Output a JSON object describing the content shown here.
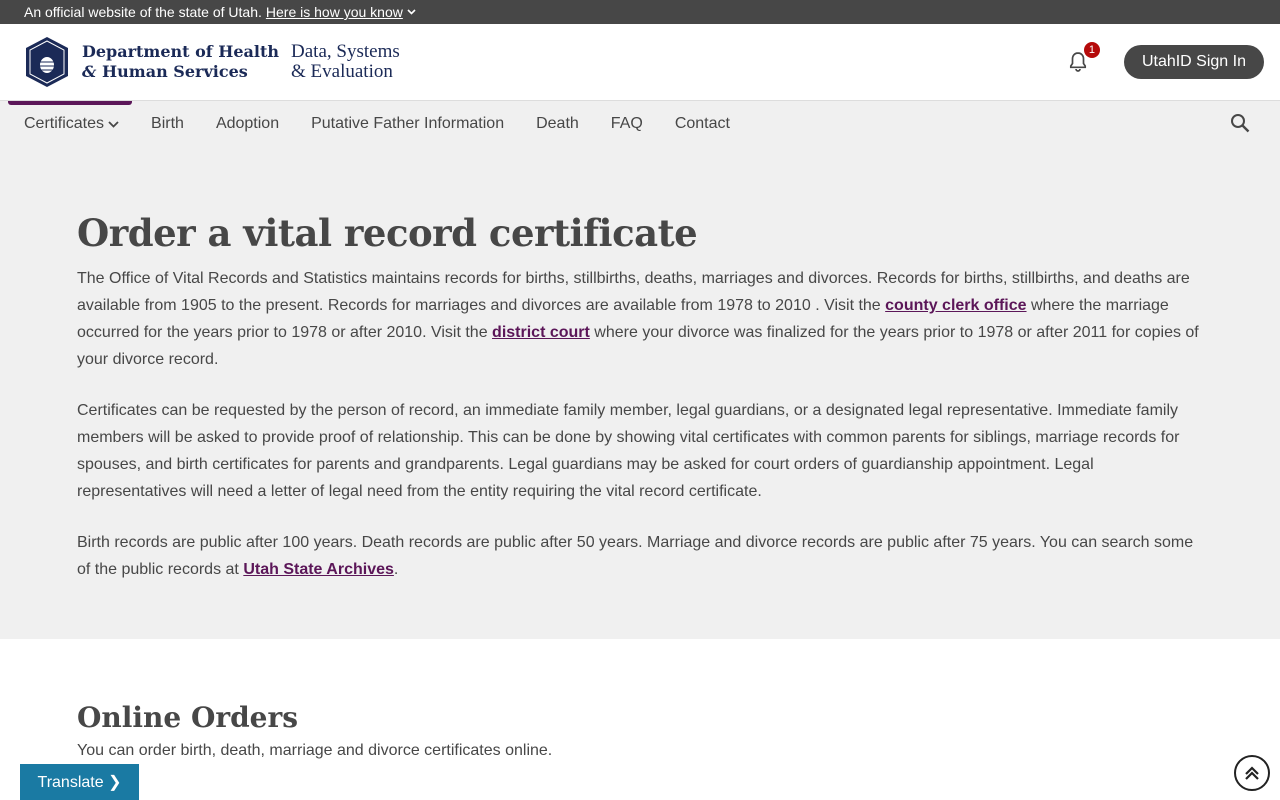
{
  "gov_banner": {
    "text": "An official website of the state of Utah.",
    "link": "Here is how you know"
  },
  "header": {
    "dept_line1": "Department of Health",
    "dept_line2_amp": "&",
    "dept_line2": "Human Services",
    "sub_line1": "Data, Systems",
    "sub_line2": "& Evaluation",
    "notification_count": "1",
    "signin_label": "UtahID Sign In"
  },
  "nav": {
    "items": [
      "Certificates",
      "Birth",
      "Adoption",
      "Putative Father Information",
      "Death",
      "FAQ",
      "Contact"
    ]
  },
  "hero": {
    "title": "Order a vital record certificate",
    "p1_a": "The Office of Vital Records and Statistics maintains records for births, stillbirths, deaths, marriages and divorces. Records for births, stillbirths, and deaths are available from 1905 to the present. Records for marriages and divorces are available from 1978 to 2010 . Visit the ",
    "p1_link1": "county clerk office",
    "p1_b": " where the marriage occurred for the years prior to 1978 or after 2010. Visit the ",
    "p1_link2": "district court",
    "p1_c": " where your divorce was finalized for the years prior to 1978 or after 2011 for copies of your divorce record.",
    "p2": "Certificates can be requested by the person of record, an immediate family member, legal guardians, or a designated legal representative. Immediate family members will be asked to provide proof of relationship. This can be done by showing vital certificates with common parents for siblings, marriage records for spouses, and birth certificates for parents and grandparents. Legal guardians may be asked for court orders of guardianship appointment. Legal representatives will need a letter of legal need from the entity requiring the vital record certificate.",
    "p3_a": "Birth records are public after 100 years. Death records are public after 50 years. Marriage and divorce records are public after 75 years. You can search some of the public records at ",
    "p3_link": "Utah State Archives",
    "p3_b": "."
  },
  "online": {
    "title": "Online Orders",
    "text": "You can order birth, death, marriage and divorce certificates online."
  },
  "translate_label": "Translate ❯",
  "colors": {
    "banner": "#474747",
    "brand_navy": "#1b2a57",
    "accent_purple": "#5b1658",
    "translate_blue": "#1a7aa3",
    "hero_bg": "#f0f0f0"
  },
  "icons": [
    "utah-seal-icon",
    "chevron-down-icon",
    "bell-icon",
    "search-icon",
    "arrow-up-icon"
  ]
}
